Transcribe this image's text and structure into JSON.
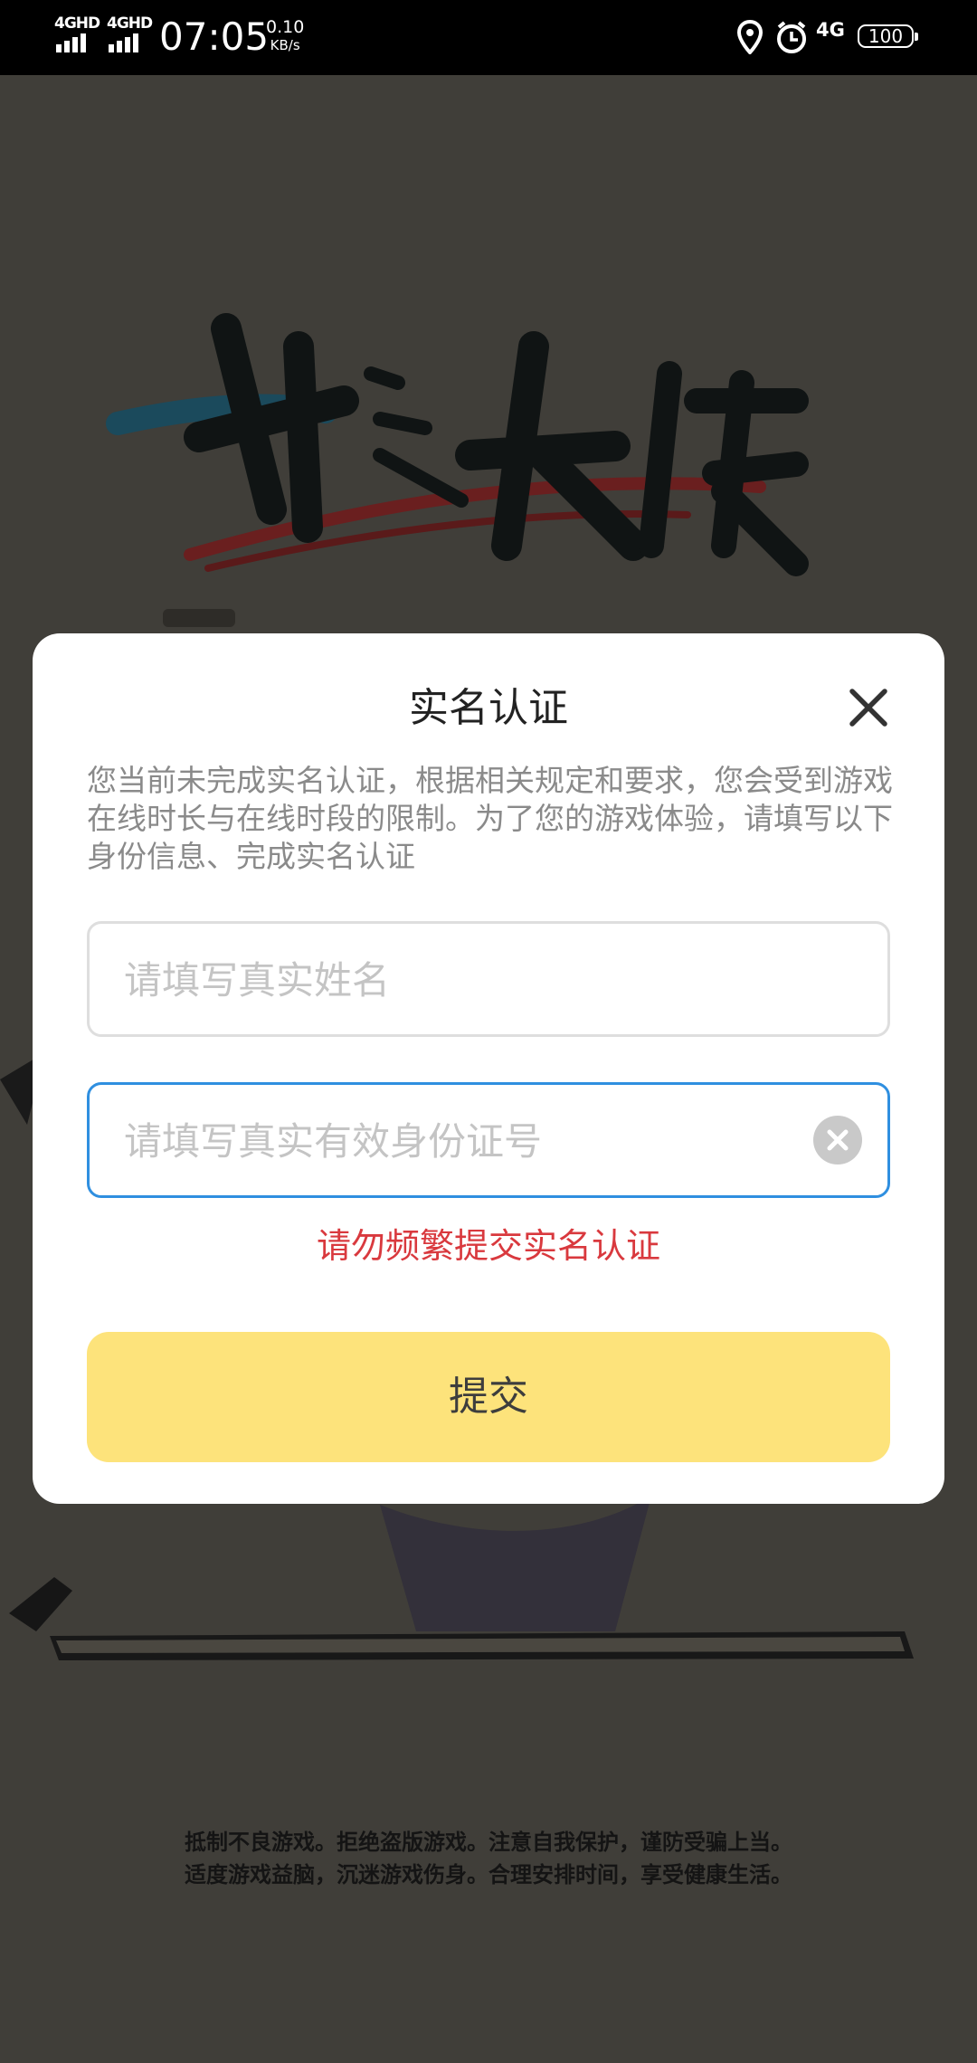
{
  "status_bar": {
    "network_1": "4GHD",
    "network_2": "4GHD",
    "time": "07:05",
    "speed_value": "0.10",
    "speed_unit": "KB/s",
    "data_type": "4G",
    "battery": "100",
    "icons": [
      "signal-icon",
      "signal-icon",
      "location-icon",
      "alarm-icon",
      "battery-icon"
    ]
  },
  "game": {
    "logo_text": "我也是大侠",
    "tips_line1": "抵制不良游戏。拒绝盗版游戏。注意自我保护，谨防受骗上当。",
    "tips_line2": "适度游戏益脑，沉迷游戏伤身。合理安排时间，享受健康生活。"
  },
  "dialog": {
    "title": "实名认证",
    "description": "您当前未完成实名认证，根据相关规定和要求，您会受到游戏在线时长与在线时段的限制。为了您的游戏体验，请填写以下身份信息、完成实名认证",
    "name_field": {
      "value": "",
      "placeholder": "请填写真实姓名"
    },
    "id_field": {
      "value": "",
      "placeholder": "请填写真实有效身份证号"
    },
    "error": "请勿频繁提交实名认证",
    "submit_label": "提交"
  },
  "colors": {
    "accent_button": "#fde37b",
    "error_text": "#d9393e",
    "active_border": "#2f8fe0",
    "overlay_bg": "#403e39"
  }
}
